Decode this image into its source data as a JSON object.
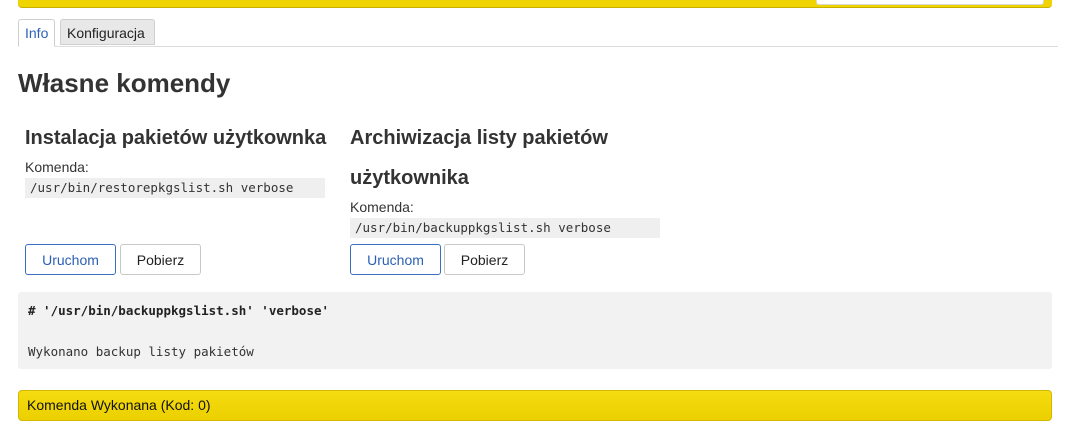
{
  "tabs": [
    {
      "label": "Info",
      "active": true
    },
    {
      "label": "Konfiguracja",
      "active": false
    }
  ],
  "page_title": "Własne komendy",
  "commands": [
    {
      "title": "Instalacja pakietów użytkownka",
      "label": "Komenda:",
      "command": "/usr/bin/restorepkgslist.sh verbose",
      "run_label": "Uruchom",
      "download_label": "Pobierz"
    },
    {
      "title_line1": "Archiwizacja listy pakietów",
      "title_line2": "użytkownika",
      "label": "Komenda:",
      "command": "/usr/bin/backuppkgslist.sh verbose",
      "run_label": "Uruchom",
      "download_label": "Pobierz"
    }
  ],
  "output": {
    "command_line": "# '/usr/bin/backuppkgslist.sh' 'verbose'",
    "result": "Wykonano backup listy pakietów"
  },
  "status": {
    "text": "Komenda Wykonana (Kod: 0)"
  },
  "colors": {
    "accent_yellow": "#f0d400",
    "link_blue": "#2b63b5"
  }
}
